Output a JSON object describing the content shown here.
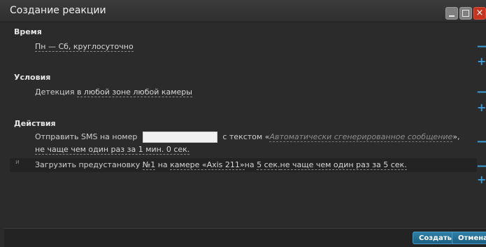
{
  "window": {
    "title": "Создание реакции"
  },
  "sections": {
    "time": {
      "header": "Время",
      "row_text": "Пн — Сб, круглосуточно"
    },
    "conditions": {
      "header": "Условия",
      "prefix": "Детекция ",
      "link": "в любой зоне любой камеры"
    },
    "actions": {
      "header": "Действия",
      "sms": {
        "prefix": "Отправить SMS на номер",
        "mid": "с текстом «",
        "message": "Автоматически сгенерированное сообщение",
        "close_quote": "»",
        "comma": ",",
        "freq_link": "не чаще чем один раз за 1 мин. 0 сек.",
        "phone_value": ""
      },
      "preset": {
        "mark": "и",
        "text_part1": "Загрузить предустановку ",
        "preset_link": "№1",
        "text_part2": " на ",
        "camera_link": "камере «Axis 211»",
        "text_part3": "на ",
        "time_link": "5 сек.",
        "freq_link": "не чаще чем один раз за 5 сек."
      }
    }
  },
  "controls": {
    "minus": "—",
    "plus": "+"
  },
  "footer": {
    "create_label": "Создать",
    "cancel_label": "Отмена"
  },
  "colors": {
    "accent": "#3c9bd6",
    "close": "#c4341e"
  }
}
